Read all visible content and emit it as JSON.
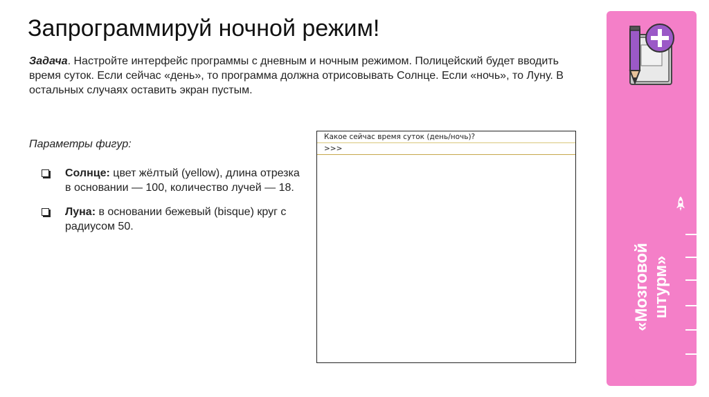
{
  "title": "Запрограммируй ночной режим!",
  "task": {
    "label": "Задача",
    "text": ". Настройте интерфейс программы с дневным и ночным режимом. Полицейский будет вводить время суток. Если сейчас «день», то программа должна отрисовывать Солнце. Если «ночь», то Луну. В остальных случаях оставить экран пустым."
  },
  "params_title": "Параметры фигур:",
  "shapes": [
    {
      "name": "Солнце:",
      "text": " цвет жёлтый (yellow), длина отрезка в основании — 100, количество лучей — 18."
    },
    {
      "name": "Луна:",
      "text": " в основании бежевый (bisque) круг с радиусом 50."
    }
  ],
  "console": {
    "prompt_line": "Какое сейчас время суток (день/ночь)?",
    "input_line": ">>>"
  },
  "sidebar": {
    "label": "«Мозговой\nштурм»",
    "color": "#f47fc8"
  },
  "icons": {
    "top": "notebook-pencil-plus-icon",
    "middle": "rocket-icon"
  }
}
